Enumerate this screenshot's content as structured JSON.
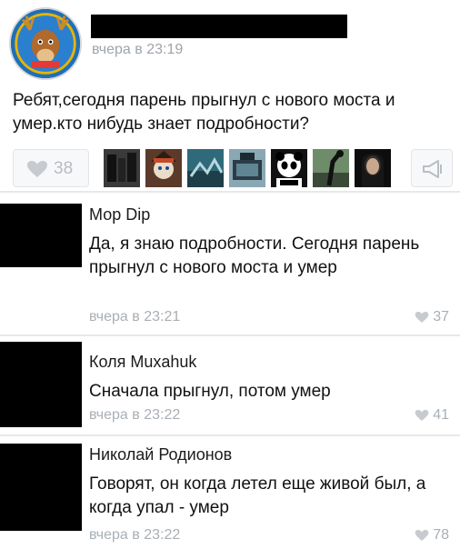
{
  "post": {
    "time": "вчера в 23:19",
    "text": "Ребят,сегодня парень прыгнул с нового моста и умер.кто нибудь знает подробности?",
    "likes": "38",
    "likers": [
      {
        "name": "liker-avatar"
      },
      {
        "name": "liker-avatar"
      },
      {
        "name": "liker-avatar"
      },
      {
        "name": "liker-avatar"
      },
      {
        "name": "liker-avatar"
      },
      {
        "name": "liker-avatar"
      },
      {
        "name": "liker-avatar"
      }
    ]
  },
  "comments": [
    {
      "author": "Мор Dip",
      "text": "Да, я знаю подробности. Сегодня парень прыгнул с нового моста и умер",
      "time": "вчера в 23:21",
      "likes": "37"
    },
    {
      "author": "Коля Muxahuk",
      "text": "Сначала прыгнул, потом умер",
      "time": "вчера в 23:22",
      "likes": "41"
    },
    {
      "author": "Николай Родионов",
      "text": "Говорят, он когда летел еще живой был, а когда упал - умер",
      "time": "вчера в 23:22",
      "likes": "78"
    }
  ],
  "colors": {
    "meta_gray": "#a9afb5",
    "text": "#111111",
    "redaction": "#000000"
  }
}
